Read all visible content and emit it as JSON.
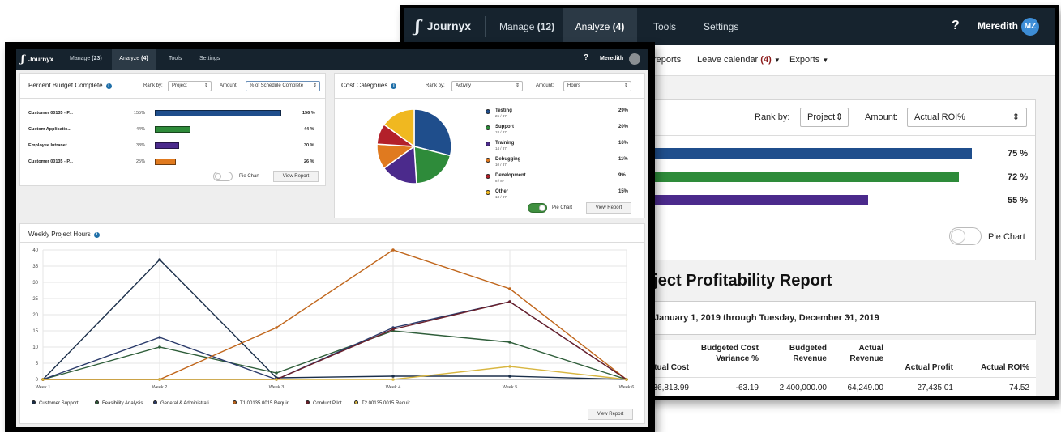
{
  "back": {
    "brand": "Journyx",
    "nav": [
      {
        "label": "Manage",
        "count": "(12)"
      },
      {
        "label": "Analyze",
        "count": "(4)"
      },
      {
        "label": "Tools",
        "count": ""
      },
      {
        "label": "Settings",
        "count": ""
      }
    ],
    "help": "?",
    "user": "Meredith",
    "initials": "MZ",
    "subnav": {
      "reports": "reports",
      "leave_label": "Leave calendar",
      "leave_count": "(4)",
      "exports": "Exports"
    },
    "rank_label": "Rank by:",
    "rank_value": "Project",
    "amount_label": "Amount:",
    "amount_value": "Actual ROI%",
    "bars": [
      {
        "pct": "75 %",
        "color": "#1f4e8c"
      },
      {
        "pct": "72 %",
        "color": "#2e8b3a"
      },
      {
        "pct": "55 %",
        "color": "#4b2a8c"
      }
    ],
    "pie_chart_label": "Pie Chart",
    "report_title": "oject Profitability Report",
    "date_range": "January 1, 2019 through Tuesday, December 31, 2019",
    "table": {
      "headers": [
        "tual Cost",
        "Budgeted Cost Variance %",
        "Budgeted Revenue",
        "Actual Revenue",
        "Actual Profit",
        "Actual ROI%"
      ],
      "row": [
        "36,813.99",
        "-63.19",
        "2,400,000.00",
        "64,249.00",
        "27,435.01",
        "74.52"
      ]
    }
  },
  "front": {
    "brand": "Journyx",
    "nav": [
      {
        "label": "Manage",
        "count": "(23)"
      },
      {
        "label": "Analyze",
        "count": "(4)"
      },
      {
        "label": "Tools",
        "count": ""
      },
      {
        "label": "Settings",
        "count": ""
      }
    ],
    "help": "?",
    "user": "Meredith",
    "budget": {
      "title": "Percent Budget Complete",
      "rank_label": "Rank by:",
      "rank_value": "Project",
      "amount_label": "Amount:",
      "amount_value": "% of Schedule Complete",
      "rows": [
        {
          "name": "Customer 00135 - P...",
          "pct": "155%",
          "value": 156,
          "pct2": "156 %",
          "color": "#1f4e8c"
        },
        {
          "name": "Custom Applicatio...",
          "pct": "44%",
          "value": 44,
          "pct2": "44 %",
          "color": "#2e8b3a"
        },
        {
          "name": "Employee Intranet...",
          "pct": "33%",
          "value": 30,
          "pct2": "30 %",
          "color": "#4b2a8c"
        },
        {
          "name": "Customer 00135 - P...",
          "pct": "25%",
          "value": 26,
          "pct2": "26 %",
          "color": "#e07a1f"
        }
      ],
      "pie_label": "Pie Chart",
      "view_report": "View Report"
    },
    "cost": {
      "title": "Cost Categories",
      "rank_label": "Rank by:",
      "rank_value": "Activity",
      "amount_label": "Amount:",
      "amount_value": "Hours",
      "items": [
        {
          "name": "Testing",
          "sub": "26 / 87",
          "pct": "29%",
          "value": 29,
          "color": "#1f4e8c"
        },
        {
          "name": "Support",
          "sub": "18 / 87",
          "pct": "20%",
          "value": 20,
          "color": "#2e8b3a"
        },
        {
          "name": "Training",
          "sub": "14 / 87",
          "pct": "16%",
          "value": 16,
          "color": "#4b2a8c"
        },
        {
          "name": "Debugging",
          "sub": "10 / 87",
          "pct": "11%",
          "value": 11,
          "color": "#e07a1f"
        },
        {
          "name": "Development",
          "sub": "8 / 87",
          "pct": "9%",
          "value": 9,
          "color": "#b3202a"
        },
        {
          "name": "Other",
          "sub": "13 / 87",
          "pct": "15%",
          "value": 15,
          "color": "#f0b820"
        }
      ],
      "pie_label": "Pie Chart",
      "view_report": "View Report"
    },
    "weekly": {
      "title": "Weekly Project Hours",
      "view_report": "View Report"
    }
  },
  "chart_data": {
    "type": "line",
    "x": [
      "Week 1",
      "Week 2",
      "Week 3",
      "Week 4",
      "Week 5",
      "Week 6"
    ],
    "ylim": [
      0,
      40
    ],
    "yticks": [
      0,
      5,
      10,
      15,
      20,
      25,
      30,
      35,
      40
    ],
    "series": [
      {
        "name": "Customer Support",
        "color": "#1b2f4a",
        "values": [
          0,
          37,
          0.5,
          1,
          1,
          0
        ]
      },
      {
        "name": "Feasibility Analysis",
        "color": "#2f5e3a",
        "values": [
          0,
          10,
          2,
          15,
          11.5,
          0
        ]
      },
      {
        "name": "General & Administrati...",
        "color": "#2a3a6a",
        "values": [
          0,
          13,
          0,
          16,
          24,
          0
        ]
      },
      {
        "name": "T1 00135 0015 Requir...",
        "color": "#c0651a",
        "values": [
          0,
          0,
          16,
          40,
          28,
          0
        ]
      },
      {
        "name": "Conduct Pilot",
        "color": "#6a1f2a",
        "values": [
          0,
          0,
          0,
          15.5,
          24,
          0
        ]
      },
      {
        "name": "T2 00135 0015 Requir...",
        "color": "#d8b640",
        "values": [
          0,
          0,
          0,
          0,
          4,
          0
        ]
      }
    ]
  }
}
